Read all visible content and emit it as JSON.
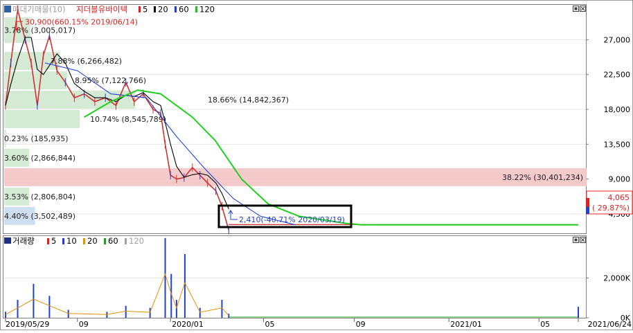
{
  "price_panel": {
    "legend_a": "매대기매물(10)",
    "legend_b": "지더블유바이텍",
    "ma": [
      {
        "label": "5",
        "color": "#e02020"
      },
      {
        "label": "20",
        "color": "#000000"
      },
      {
        "label": "60",
        "color": "#2040d0"
      },
      {
        "label": "120",
        "color": "#20c020"
      }
    ],
    "high_annotation": "30,900(660.15% 2019/06/14)",
    "low_annotation": "2,410(-40.71% 2020/03/19)",
    "current_value": "4,065",
    "current_change": "( 29.87%)",
    "y_ticks": [
      "27,000",
      "22,500",
      "18,000",
      "13,500",
      "9,000",
      "4,500"
    ]
  },
  "volume_panel": {
    "legend_title": "거래량",
    "ma": [
      {
        "label": "5",
        "color": "#e02020"
      },
      {
        "label": "10",
        "color": "#2040d0"
      },
      {
        "label": "20",
        "color": "#e09000"
      },
      {
        "label": "60",
        "color": "#20a020"
      },
      {
        "label": "120",
        "color": "#a0a0a0"
      }
    ],
    "y_ticks": [
      "2,000K",
      "0K"
    ]
  },
  "x_labels": [
    "2019/05/29",
    "09",
    "2020/01",
    "05",
    "09",
    "2021/01",
    "05",
    "2021/06/24"
  ],
  "chart_data": {
    "type": "line",
    "title": "지더블유바이텍",
    "price_ylim": [
      2000,
      31500
    ],
    "volume_ylim": [
      0,
      4100
    ],
    "volume_unit": "K",
    "ma_periods": [
      5,
      20,
      60,
      120
    ],
    "volume_profile": [
      {
        "price_low": 26500,
        "price_high": 30000,
        "label": "3.78% (3,005,017)",
        "length": 0.045
      },
      {
        "price_low": 23000,
        "price_high": 25500,
        "label": "7.88% (6,266,482)",
        "length": 0.095
      },
      {
        "price_low": 20500,
        "price_high": 23000,
        "label": "8.95% (7,122,766)",
        "length": 0.108
      },
      {
        "price_low": 18000,
        "price_high": 20500,
        "label": "18.66% (14,842,367)",
        "length": 0.225
      },
      {
        "price_low": 15500,
        "price_high": 18000,
        "label": "10.74% (8,545,789)",
        "length": 0.13
      },
      {
        "price_low": 13000,
        "price_high": 15500,
        "label": "0.23% (185,935)",
        "length": 0.003
      },
      {
        "price_low": 10500,
        "price_high": 13000,
        "label": "3.60% (2,866,844)",
        "length": 0.043
      },
      {
        "price_low": 8000,
        "price_high": 10500,
        "label": "38.22% (30,401,234)",
        "length": 0.46,
        "highlight": true
      },
      {
        "price_low": 5500,
        "price_high": 8000,
        "label": "3.53% (2,806,804)",
        "length": 0.043
      },
      {
        "price_low": 3000,
        "price_high": 5500,
        "label": "4.40% (3,502,489)",
        "length": 0.053
      }
    ],
    "close_series": [
      {
        "x": "2019-05-29",
        "y": 18500
      },
      {
        "x": "2019-06-05",
        "y": 24000
      },
      {
        "x": "2019-06-14",
        "y": 30900
      },
      {
        "x": "2019-06-24",
        "y": 27000
      },
      {
        "x": "2019-07-02",
        "y": 24000
      },
      {
        "x": "2019-07-10",
        "y": 18500
      },
      {
        "x": "2019-07-18",
        "y": 25000
      },
      {
        "x": "2019-07-26",
        "y": 27500
      },
      {
        "x": "2019-08-05",
        "y": 23000
      },
      {
        "x": "2019-08-16",
        "y": 21500
      },
      {
        "x": "2019-08-28",
        "y": 19500
      },
      {
        "x": "2019-09-10",
        "y": 20000
      },
      {
        "x": "2019-09-24",
        "y": 19000
      },
      {
        "x": "2019-10-08",
        "y": 19500
      },
      {
        "x": "2019-10-22",
        "y": 18500
      },
      {
        "x": "2019-11-04",
        "y": 21500
      },
      {
        "x": "2019-11-15",
        "y": 19000
      },
      {
        "x": "2019-11-27",
        "y": 20000
      },
      {
        "x": "2019-12-10",
        "y": 18000
      },
      {
        "x": "2019-12-20",
        "y": 17500
      },
      {
        "x": "2019-12-26",
        "y": 13500
      },
      {
        "x": "2020-01-02",
        "y": 9500
      },
      {
        "x": "2020-01-10",
        "y": 9000
      },
      {
        "x": "2020-01-20",
        "y": 9200
      },
      {
        "x": "2020-01-31",
        "y": 10500
      },
      {
        "x": "2020-02-10",
        "y": 9500
      },
      {
        "x": "2020-02-20",
        "y": 8500
      },
      {
        "x": "2020-03-02",
        "y": 7500
      },
      {
        "x": "2020-03-10",
        "y": 5500
      },
      {
        "x": "2020-03-19",
        "y": 2410
      },
      {
        "x": "2021-06-23",
        "y": 3130
      },
      {
        "x": "2021-06-24",
        "y": 4065
      }
    ],
    "ma120_series": [
      {
        "x": "2019-09-10",
        "y": 17000
      },
      {
        "x": "2019-10-15",
        "y": 19000
      },
      {
        "x": "2019-11-20",
        "y": 20500
      },
      {
        "x": "2019-12-20",
        "y": 20000
      },
      {
        "x": "2020-01-31",
        "y": 17000
      },
      {
        "x": "2020-03-01",
        "y": 14000
      },
      {
        "x": "2020-04-05",
        "y": 9000
      },
      {
        "x": "2020-05-10",
        "y": 5800
      },
      {
        "x": "2020-06-20",
        "y": 4200
      },
      {
        "x": "2020-08-20",
        "y": 3300
      },
      {
        "x": "2020-09-10",
        "y": 3100
      },
      {
        "x": "2021-06-24",
        "y": 3100
      }
    ],
    "ma60_series": [
      {
        "x": "2019-07-20",
        "y": 24000
      },
      {
        "x": "2019-09-01",
        "y": 23000
      },
      {
        "x": "2019-10-15",
        "y": 20000
      },
      {
        "x": "2019-12-01",
        "y": 19500
      },
      {
        "x": "2020-01-10",
        "y": 14500
      },
      {
        "x": "2020-02-15",
        "y": 10500
      },
      {
        "x": "2020-03-25",
        "y": 6500
      },
      {
        "x": "2020-04-30",
        "y": 4200
      },
      {
        "x": "2020-06-15",
        "y": 3100
      }
    ],
    "volume_series": [
      {
        "x": "2019-05-29",
        "y": 300
      },
      {
        "x": "2019-06-14",
        "y": 900
      },
      {
        "x": "2019-07-05",
        "y": 1700
      },
      {
        "x": "2019-07-26",
        "y": 1100
      },
      {
        "x": "2019-08-20",
        "y": 400
      },
      {
        "x": "2019-10-10",
        "y": 300
      },
      {
        "x": "2019-11-04",
        "y": 600
      },
      {
        "x": "2019-12-06",
        "y": 500
      },
      {
        "x": "2019-12-26",
        "y": 4000
      },
      {
        "x": "2020-01-03",
        "y": 2200
      },
      {
        "x": "2020-01-10",
        "y": 900
      },
      {
        "x": "2020-01-21",
        "y": 3200
      },
      {
        "x": "2020-02-10",
        "y": 500
      },
      {
        "x": "2020-03-10",
        "y": 900
      },
      {
        "x": "2020-03-19",
        "y": 200
      },
      {
        "x": "2021-06-24",
        "y": 550
      }
    ]
  }
}
